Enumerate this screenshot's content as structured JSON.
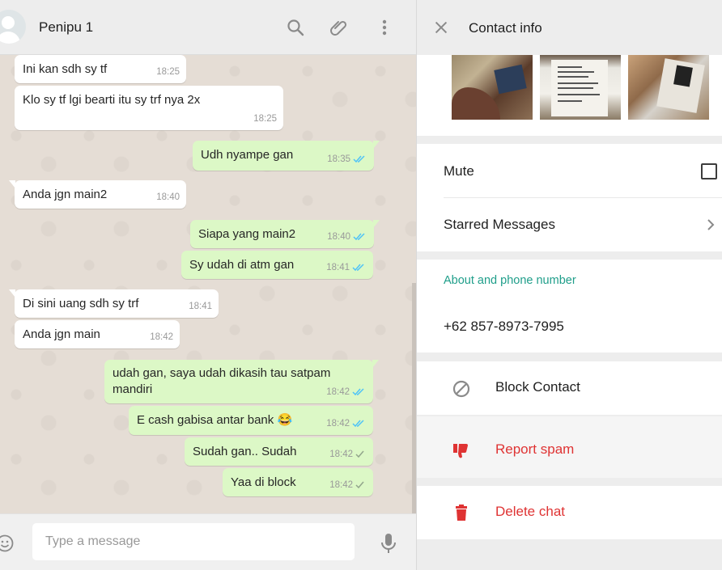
{
  "chat": {
    "contact_name": "Penipu 1",
    "header_icons": [
      "search-icon",
      "paperclip-icon",
      "more-vert-icon"
    ],
    "messages": [
      {
        "direction": "in",
        "text": "Ini kan sdh sy tf",
        "time": "18:25"
      },
      {
        "direction": "in",
        "text": "Klo sy tf lgi bearti itu sy trf nya 2x",
        "time": "18:25"
      },
      {
        "direction": "out",
        "text": "Udh nyampe gan",
        "time": "18:35",
        "status": "read"
      },
      {
        "direction": "in",
        "text": "Anda jgn main2",
        "time": "18:40"
      },
      {
        "direction": "out",
        "text": "Siapa yang main2",
        "time": "18:40",
        "status": "read"
      },
      {
        "direction": "out",
        "text": "Sy udah di atm gan",
        "time": "18:41",
        "status": "read"
      },
      {
        "direction": "in",
        "text": "Di sini uang sdh sy trf",
        "time": "18:41"
      },
      {
        "direction": "in",
        "text": "Anda jgn main",
        "time": "18:42"
      },
      {
        "direction": "out",
        "text": "udah gan, saya udah dikasih tau satpam mandiri",
        "time": "18:42",
        "status": "read"
      },
      {
        "direction": "out",
        "text": "E cash gabisa antar bank 😂",
        "time": "18:42",
        "status": "read"
      },
      {
        "direction": "out",
        "text": "Sudah gan.. Sudah",
        "time": "18:42",
        "status": "sent"
      },
      {
        "direction": "out",
        "text": "Yaa di block",
        "time": "18:42",
        "status": "sent"
      }
    ],
    "composer": {
      "placeholder": "Type a message"
    }
  },
  "contact_info": {
    "title": "Contact info",
    "media": [
      "photo",
      "document-photo",
      "photo"
    ],
    "mute_label": "Mute",
    "mute_checked": false,
    "starred_label": "Starred Messages",
    "about_heading": "About and phone number",
    "phone": "+62 857-8973-7995",
    "actions": {
      "block": "Block Contact",
      "report": "Report spam",
      "delete": "Delete chat"
    }
  },
  "colors": {
    "outgoing_bubble": "#dcf8c6",
    "incoming_bubble": "#ffffff",
    "chat_background": "#e5ddd5",
    "teal_accent": "#1f9e8a",
    "danger_red": "#df3333",
    "read_ticks": "#4fc3f7"
  }
}
